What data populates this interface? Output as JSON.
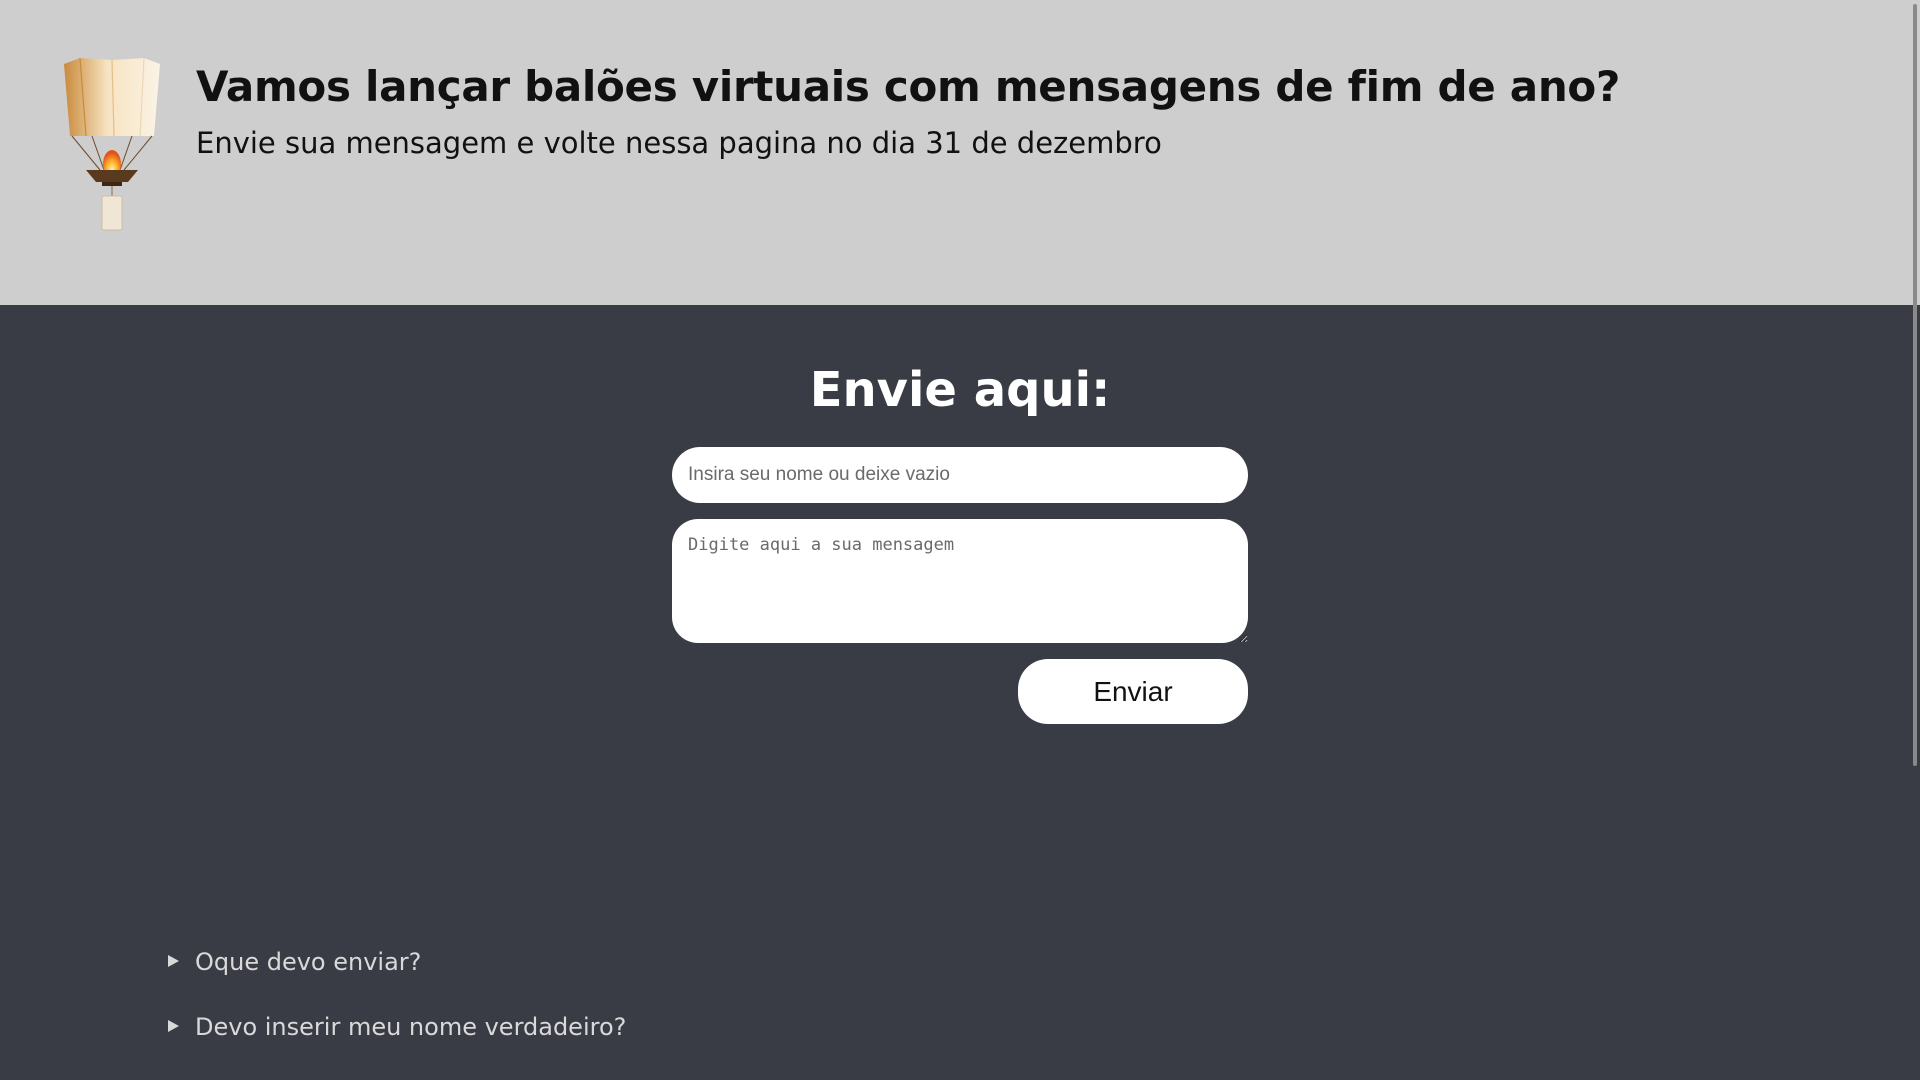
{
  "header": {
    "title": "Vamos lançar balões virtuais com mensagens de fim de ano?",
    "subtitle": "Envie sua mensagem e volte nessa pagina no dia 31 de dezembro",
    "logo_icon": "sky-lantern-icon"
  },
  "form": {
    "heading": "Envie aqui:",
    "name_placeholder": "Insira seu nome ou deixe vazio",
    "name_value": "",
    "message_placeholder": "Digite aqui a sua mensagem",
    "message_value": "",
    "submit_label": "Enviar"
  },
  "faq": {
    "items": [
      {
        "question": "Oque devo enviar?"
      },
      {
        "question": "Devo inserir meu nome verdadeiro?"
      }
    ]
  },
  "colors": {
    "header_bg": "#cecece",
    "body_bg": "#393c45",
    "text_dark": "#111111",
    "text_light": "#ffffff"
  }
}
